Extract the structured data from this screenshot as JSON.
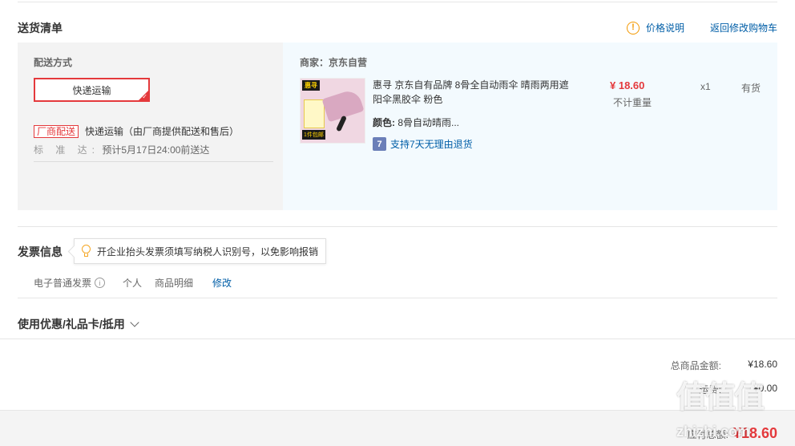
{
  "delivery": {
    "title": "送货清单",
    "price_explain": "价格说明",
    "back_to_cart": "返回修改购物车",
    "ship_method_label": "配送方式",
    "ship_method_value": "快递运输",
    "vendor_tag": "厂商配送",
    "vendor_text": "快递运输（由厂商提供配送和售后）",
    "standard_label": "标 准 达:",
    "standard_value": "预计5月17日24:00前送达"
  },
  "product": {
    "merchant": "商家：京东自营",
    "image_badge_top": "惠寻",
    "image_badge_bottom": "1件包邮",
    "name": "惠寻 京东自有品牌 8骨全自动雨伞 晴雨两用遮阳伞黑胶伞 粉色",
    "color_label": "颜色:",
    "color_value": "8骨自动晴雨...",
    "return_icon": "7",
    "return_text": "支持7天无理由退货",
    "price": "¥ 18.60",
    "weight": "不计重量",
    "qty": "x1",
    "stock": "有货"
  },
  "invoice": {
    "title": "发票信息",
    "tooltip": "开企业抬头发票须填写纳税人识别号，以免影响报销",
    "type": "电子普通发票",
    "person": "个人",
    "detail": "商品明细",
    "edit": "修改"
  },
  "coupon": {
    "title": "使用优惠/礼品卡/抵用"
  },
  "summary": {
    "goods_label": "总商品金额:",
    "goods_value": "¥18.60",
    "shipping_label": "运费:",
    "shipping_value": "¥0.00",
    "total_label": "应付总额:",
    "total_value": "¥18.60"
  },
  "watermark": {
    "chars": "值值值",
    "text": "zhizhi.com"
  },
  "colors": {
    "accent_red": "#e4393c",
    "link_blue": "#005ea7",
    "warning_orange": "#f39800",
    "panel_blue": "#f3fafe",
    "panel_gray": "#f3f3f3"
  }
}
